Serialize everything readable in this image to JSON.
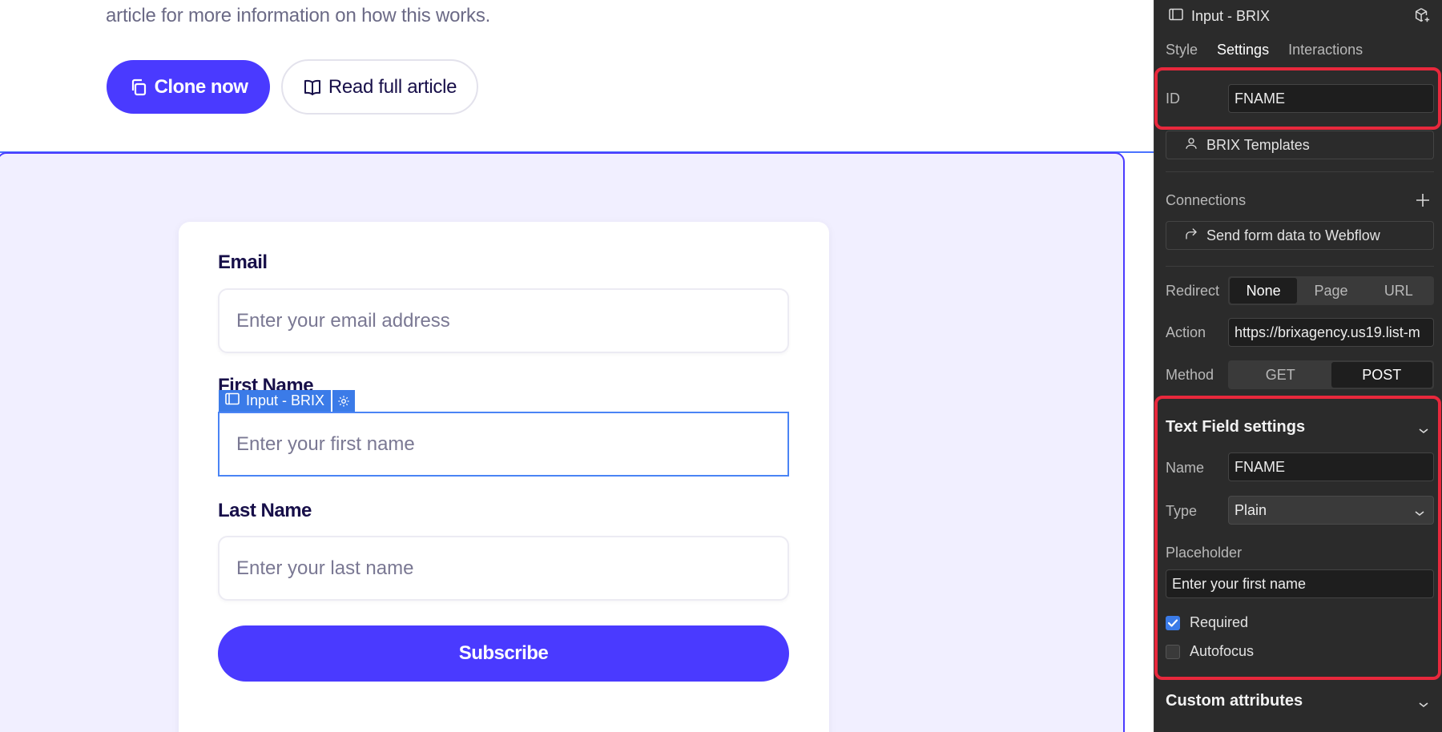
{
  "canvas": {
    "intro_text": "article for more information on how this works.",
    "clone_button": "Clone now",
    "read_button": "Read full article",
    "form": {
      "email_label": "Email",
      "email_placeholder": "Enter your email address",
      "first_name_label": "First Name",
      "first_name_placeholder": "Enter your first name",
      "last_name_label": "Last Name",
      "last_name_placeholder": "Enter your last name",
      "subscribe_button": "Subscribe"
    },
    "selection_tag": "Input - BRIX"
  },
  "panel": {
    "header_title": "Input - BRIX",
    "tabs": [
      "Style",
      "Settings",
      "Interactions"
    ],
    "active_tab": "Settings",
    "id_label": "ID",
    "id_value": "FNAME",
    "owner_button": "BRIX Templates",
    "connections_label": "Connections",
    "send_button": "Send form data to Webflow",
    "redirect_label": "Redirect",
    "redirect_options": [
      "None",
      "Page",
      "URL"
    ],
    "redirect_selected": "None",
    "action_label": "Action",
    "action_value": "https://brixagency.us19.list-m",
    "method_label": "Method",
    "method_options": [
      "GET",
      "POST"
    ],
    "method_selected": "POST",
    "text_field_title": "Text Field settings",
    "name_label": "Name",
    "name_value": "FNAME",
    "type_label": "Type",
    "type_value": "Plain",
    "placeholder_label": "Placeholder",
    "placeholder_value": "Enter your first name",
    "required_label": "Required",
    "required_checked": true,
    "autofocus_label": "Autofocus",
    "autofocus_checked": false,
    "custom_attributes_title": "Custom attributes"
  },
  "colors": {
    "brand": "#4a3aff",
    "selection": "#3b7be8",
    "highlight": "#e8283c",
    "panel_bg": "#2b2b2b"
  },
  "icons": [
    "copy-icon",
    "book-icon",
    "element-box-icon",
    "gear-icon",
    "add-symbol-icon",
    "user-icon",
    "plus-icon",
    "share-arrow-icon",
    "chevron-down-icon",
    "check-icon"
  ]
}
